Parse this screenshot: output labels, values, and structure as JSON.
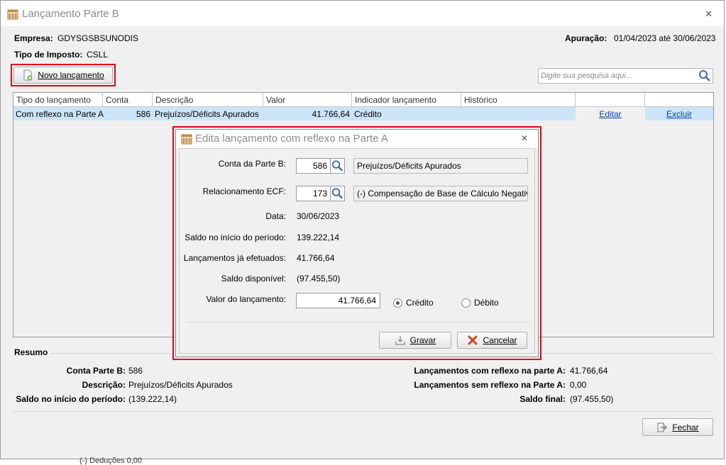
{
  "window": {
    "title": "Lançamento Parte B",
    "close": "x"
  },
  "header": {
    "empresa_label": "Empresa:",
    "empresa_value": "GDYSGSBSUNODIS",
    "tipo_label": "Tipo de Imposto:",
    "tipo_value": "CSLL",
    "apuracao_label": "Apuração:",
    "apuracao_value": "01/04/2023 até 30/06/2023"
  },
  "toolbar": {
    "novo_label": "Novo lançamento",
    "search_placeholder": "Digite sua pesquisa aqui..."
  },
  "table": {
    "columns": [
      "Tipo do lançamento",
      "Conta",
      "Descrição",
      "Valor",
      "Indicador lançamento",
      "Histórico",
      "",
      ""
    ],
    "rows": [
      {
        "tipo": "Com reflexo na Parte A",
        "conta": "586",
        "descricao": "Prejuízos/Déficits Apurados",
        "valor": "41.766,64",
        "indicador": "Crédito",
        "historico": "",
        "editar": "Editar",
        "excluir": "Excluir"
      }
    ]
  },
  "dialog": {
    "title": "Edita lançamento com reflexo na Parte A",
    "conta_label": "Conta da Parte B:",
    "conta_value": "586",
    "conta_desc": "Prejuízos/Déficits Apurados",
    "rel_label": "Relacionamento ECF:",
    "rel_value": "173",
    "rel_desc": "(-) Compensação de Base de Cálculo Negativa",
    "data_label": "Data:",
    "data_value": "30/06/2023",
    "saldo_inicio_label": "Saldo no início do período:",
    "saldo_inicio_value": "139.222,14",
    "lanc_efetuados_label": "Lançamentos já efetuados:",
    "lanc_efetuados_value": "41.766,64",
    "saldo_disp_label": "Saldo disponível:",
    "saldo_disp_value": "(97.455,50)",
    "valor_label": "Valor do lançamento:",
    "valor_value": "41.766,64",
    "credito_label": "Crédito",
    "debito_label": "Débito",
    "gravar_label": "Gravar",
    "cancelar_label": "Cancelar"
  },
  "resumo": {
    "title": "Resumo",
    "conta_label": "Conta Parte B:",
    "conta_value": "586",
    "descricao_label": "Descrição:",
    "descricao_value": "Prejuízos/Déficits Apurados",
    "saldo_inicio_label": "Saldo no início do período:",
    "saldo_inicio_value": "(139.222,14)",
    "com_reflexo_label": "Lançamentos com reflexo na parte A:",
    "com_reflexo_value": "41.766,64",
    "sem_reflexo_label": "Lançamentos sem reflexo na Parte A:",
    "sem_reflexo_value": "0,00",
    "saldo_final_label": "Saldo final:",
    "saldo_final_value": "(97.455,50)"
  },
  "footer": {
    "fechar_label": "Fechar",
    "behind_text": "(-) Deduções     0,00"
  },
  "colors": {
    "highlight": "#e3001b",
    "selection": "#cce4f7",
    "link": "#0645ad"
  }
}
